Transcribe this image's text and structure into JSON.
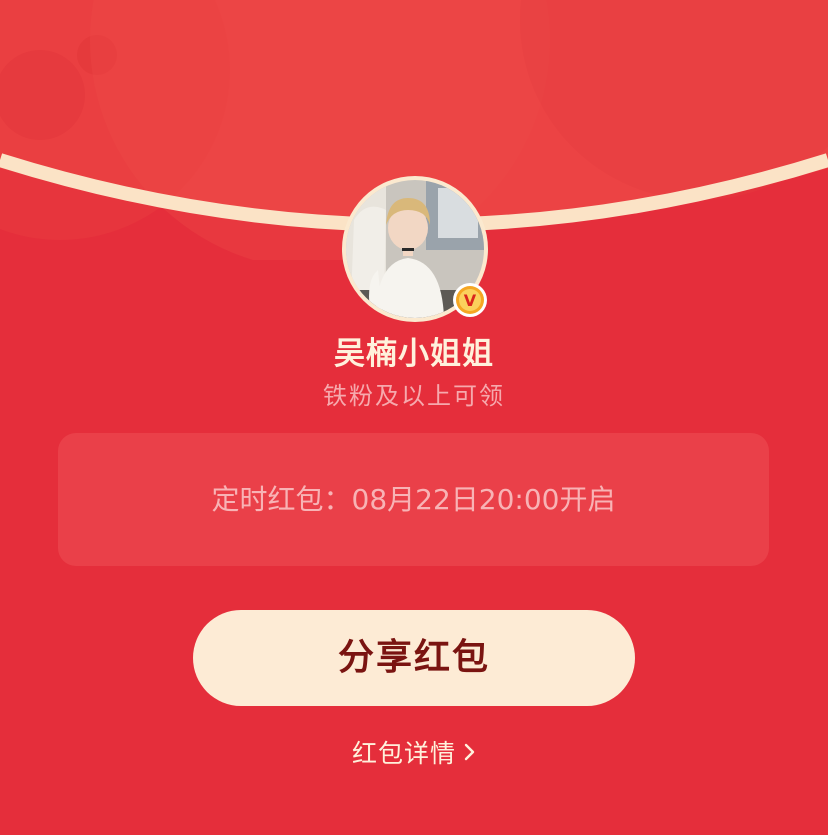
{
  "sender": {
    "name": "吴楠小姐姐",
    "verified_badge_glyph": "V"
  },
  "condition_text": "铁粉及以上可领",
  "timer": {
    "text": "定时红包：08月22日20:00开启"
  },
  "actions": {
    "share_label": "分享红包",
    "details_label": "红包详情"
  },
  "colors": {
    "background": "#e52e3b",
    "header_red": "#ec4344",
    "arc_cream": "#fbe9cf",
    "button_cream": "#fdebd5",
    "button_text": "#7a1411",
    "badge_gold": "#f5a623"
  },
  "icons": {
    "verified": "verified-v-icon",
    "details_arrow": "chevron-right-icon"
  }
}
